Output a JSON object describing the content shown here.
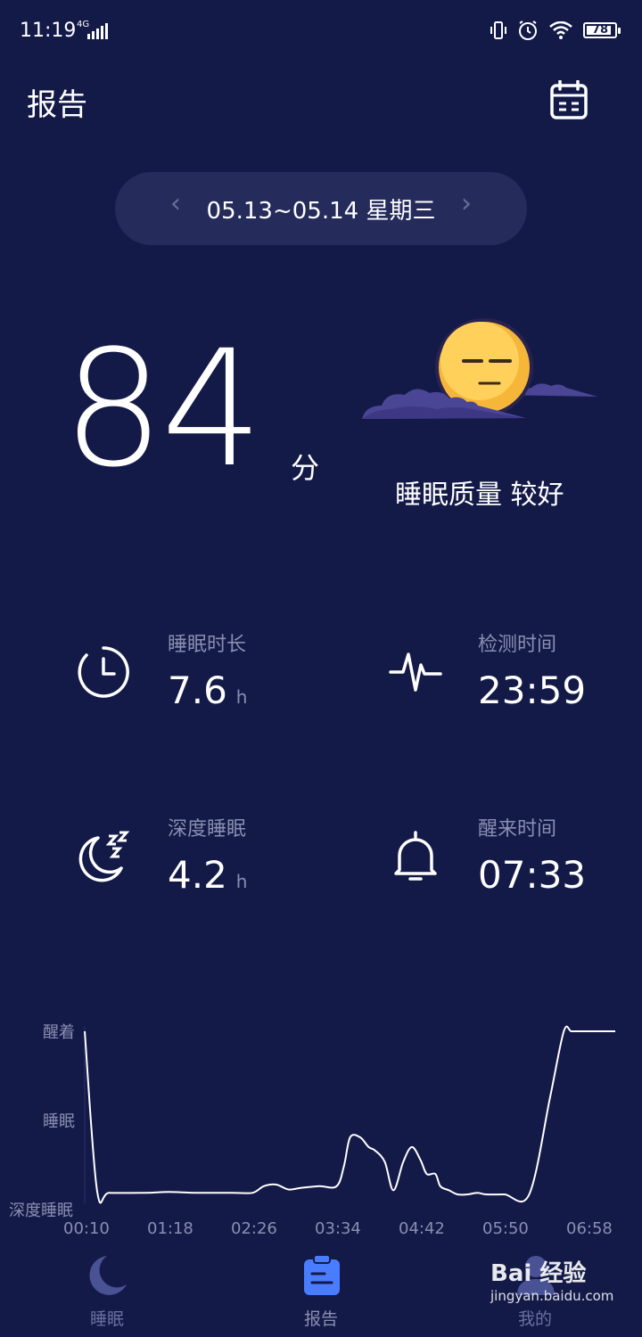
{
  "status_bar": {
    "time": "11:19",
    "network": "4G",
    "battery": "78"
  },
  "header": {
    "title": "报告",
    "calendar_icon": "calendar-icon"
  },
  "date_selector": {
    "prev": "‹",
    "next": "›",
    "text": "05.13~05.14 星期三"
  },
  "score": {
    "value": "84",
    "unit": "分",
    "quality_text": "睡眠质量 较好"
  },
  "stats": [
    {
      "label": "睡眠时长",
      "value": "7.6",
      "unit": "h",
      "icon": "clock-icon"
    },
    {
      "label": "检测时间",
      "value": "23:59",
      "unit": "",
      "icon": "heartbeat-icon"
    },
    {
      "label": "深度睡眠",
      "value": "4.2",
      "unit": "h",
      "icon": "moon-zzz-icon"
    },
    {
      "label": "醒来时间",
      "value": "07:33",
      "unit": "",
      "icon": "bell-icon"
    }
  ],
  "chart_data": {
    "type": "line",
    "y_levels": [
      "醒着",
      "睡眠",
      "深度睡眠"
    ],
    "x_ticks": [
      "00:10",
      "01:18",
      "02:26",
      "03:34",
      "04:42",
      "05:50",
      "06:58"
    ],
    "ylim": [
      0,
      2
    ],
    "grid": false,
    "series": [
      {
        "x": [
          "00:10",
          "00:20",
          "00:30",
          "01:00",
          "01:18",
          "01:40",
          "02:10",
          "02:26",
          "02:35",
          "02:45",
          "02:55",
          "03:05",
          "03:20",
          "03:34",
          "03:40",
          "03:45",
          "03:53",
          "04:00",
          "04:05",
          "04:13",
          "04:20",
          "04:28",
          "04:35",
          "04:42",
          "04:47",
          "04:54",
          "04:58",
          "05:05",
          "05:12",
          "05:20",
          "05:28",
          "05:35",
          "05:50",
          "06:10",
          "06:27",
          "06:38",
          "06:44",
          "06:51",
          "06:58"
        ],
        "y": [
          2.0,
          0.05,
          0.02,
          0.02,
          0.03,
          0.02,
          0.02,
          0.02,
          0.1,
          0.12,
          0.06,
          0.08,
          0.1,
          0.1,
          0.35,
          0.7,
          0.7,
          0.58,
          0.54,
          0.4,
          0.05,
          0.4,
          0.58,
          0.42,
          0.25,
          0.25,
          0.1,
          0.05,
          0.0,
          0.0,
          0.02,
          0.0,
          0.0,
          0.0,
          1.2,
          2.0,
          2.0,
          2.0,
          2.0
        ]
      }
    ],
    "line_color": "#ffffff"
  },
  "bottom_nav": [
    {
      "label": "睡眠",
      "icon": "moon-icon",
      "active": false
    },
    {
      "label": "报告",
      "icon": "report-icon",
      "active": true
    },
    {
      "label": "我的",
      "icon": "profile-icon",
      "active": false
    }
  ],
  "watermark": {
    "brand": "Bai 经验",
    "url": "jingyan.baidu.com"
  },
  "colors": {
    "background": "#141a48",
    "pill": "#252b5b",
    "accent": "#4a7cff",
    "muted": "#8a8eb2"
  }
}
